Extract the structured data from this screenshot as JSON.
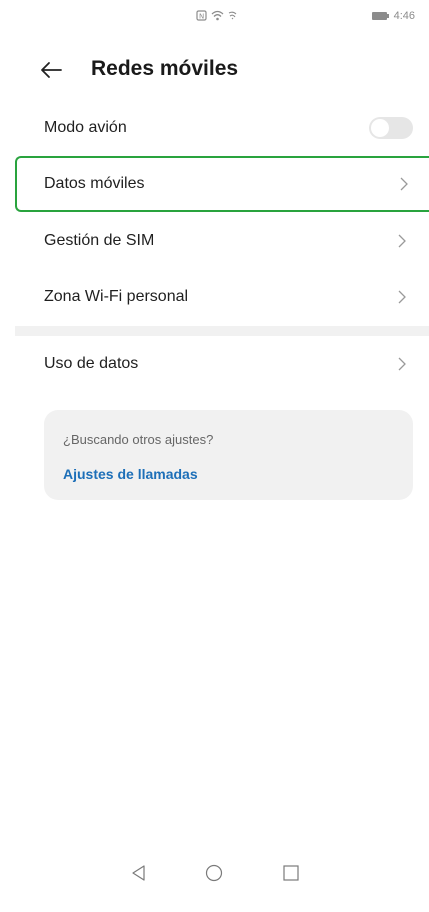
{
  "status_bar": {
    "time": "4:46",
    "icons": [
      "nfc-icon",
      "wifi-icon",
      "signal-icon",
      "battery-icon"
    ]
  },
  "header": {
    "back_icon": "arrow-left-icon",
    "title": "Redes móviles"
  },
  "settings": {
    "airplane_mode": {
      "label": "Modo avión",
      "toggle_state": "off"
    },
    "items": [
      {
        "label": "Datos móviles",
        "icon": "chevron-right-icon"
      },
      {
        "label": "Gestión de SIM",
        "icon": "chevron-right-icon"
      },
      {
        "label": "Zona Wi-Fi personal",
        "icon": "chevron-right-icon"
      }
    ],
    "data_usage": {
      "label": "Uso de datos",
      "icon": "chevron-right-icon"
    }
  },
  "suggestion_card": {
    "hint": "¿Buscando otros ajustes?",
    "link": "Ajustes de llamadas"
  },
  "nav_bar": {
    "buttons": [
      "back-triangle-icon",
      "home-circle-icon",
      "recents-square-icon"
    ]
  },
  "colors": {
    "highlight_border": "#29a33e",
    "link": "#1d6fb8",
    "card_background": "#f1f1f1"
  }
}
